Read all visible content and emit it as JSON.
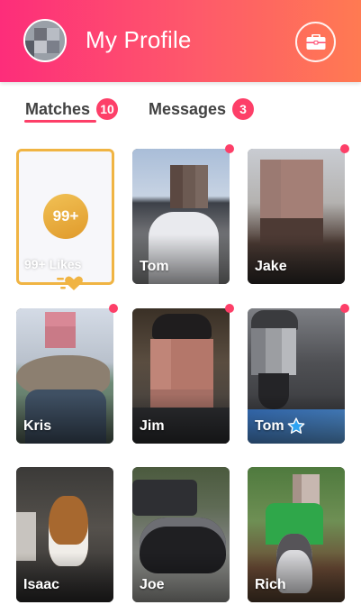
{
  "header": {
    "title": "My Profile",
    "gradient": [
      "#fd2d7a",
      "#ff7a52"
    ],
    "briefcase_icon": "briefcase-icon"
  },
  "tabs": [
    {
      "label": "Matches",
      "badge": "10",
      "active": true
    },
    {
      "label": "Messages",
      "badge": "3",
      "active": false
    }
  ],
  "likes": {
    "count": "99+",
    "label": "99+ Likes",
    "border_color": "#f0b443"
  },
  "matches": [
    {
      "name": "Tom",
      "new": true,
      "verified": false
    },
    {
      "name": "Jake",
      "new": true,
      "verified": false
    },
    {
      "name": "Kris",
      "new": true,
      "verified": false
    },
    {
      "name": "Jim",
      "new": true,
      "verified": false
    },
    {
      "name": "Tom",
      "new": true,
      "verified": true
    },
    {
      "name": "Isaac",
      "new": false,
      "verified": false
    },
    {
      "name": "Joe",
      "new": false,
      "verified": false
    },
    {
      "name": "Rich",
      "new": false,
      "verified": false
    }
  ],
  "colors": {
    "accent": "#fd3f68",
    "gold": "#f0b443",
    "verified": "#2ea3f2"
  }
}
